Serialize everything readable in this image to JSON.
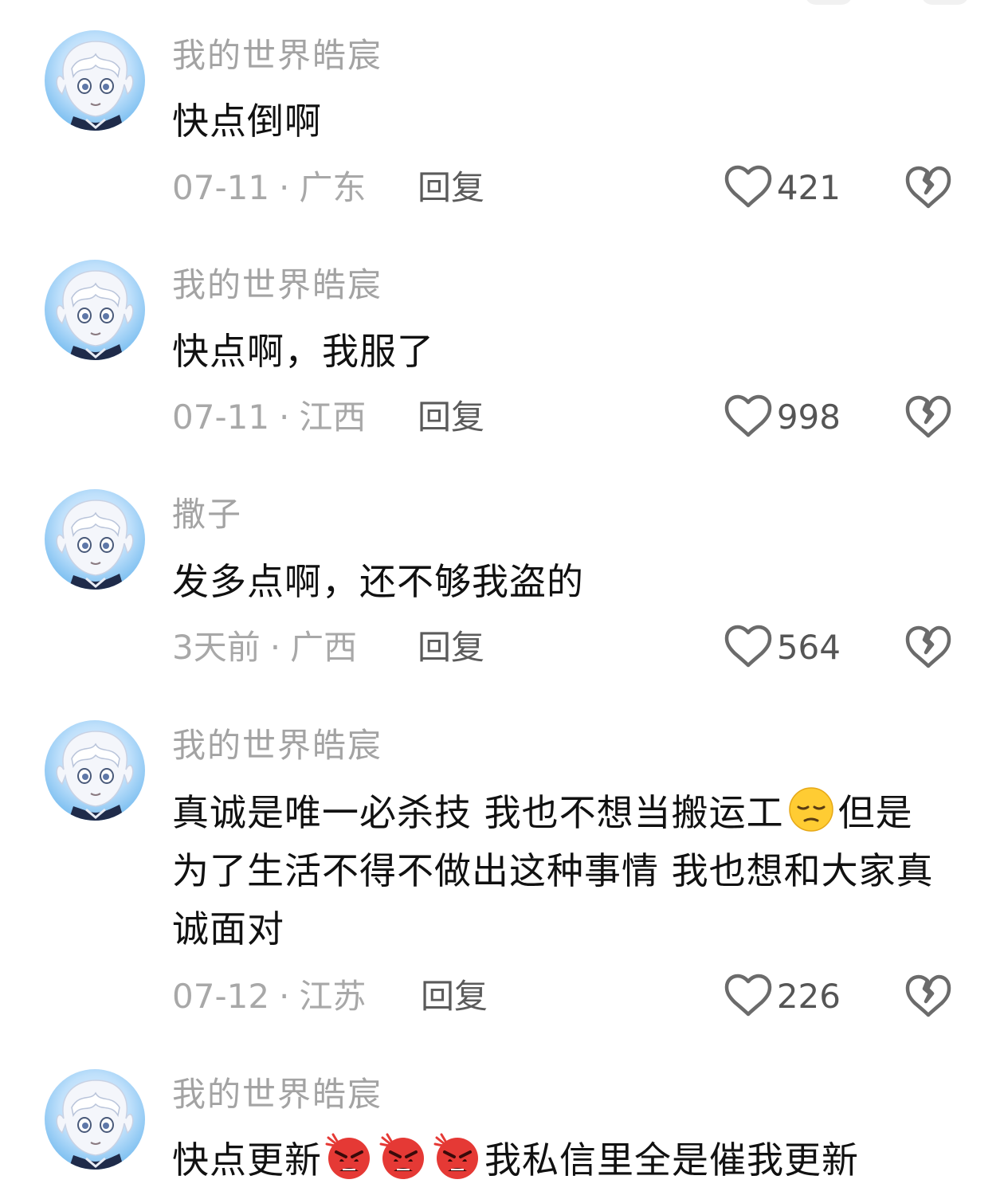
{
  "comments": [
    {
      "username": "我的世界皓宸",
      "text": "快点倒啊",
      "date": "07-11",
      "location": "广东",
      "reply_label": "回复",
      "likes": "421"
    },
    {
      "username": "我的世界皓宸",
      "text": "快点啊，我服了",
      "date": "07-11",
      "location": "江西",
      "reply_label": "回复",
      "likes": "998"
    },
    {
      "username": "撒子",
      "text": "发多点啊，还不够我盗的",
      "date": "3天前",
      "location": "广西",
      "reply_label": "回复",
      "likes": "564"
    },
    {
      "username": "我的世界皓宸",
      "text_before_emoji": "真诚是唯一必杀技 我也不想当搬运工",
      "text_after_emoji": "但是为了生活不得不做出这种事情 我也想和大家真诚面对",
      "emoji": "pensive-face-emoji",
      "date": "07-12",
      "location": "江苏",
      "reply_label": "回复",
      "likes": "226"
    },
    {
      "username": "我的世界皓宸",
      "text_before_emoji": "快点更新",
      "text_after_emoji": "我私信里全是催我更新",
      "emoji": "angry-face-emoji",
      "emoji_count": 3
    }
  ],
  "meta_separator": "·",
  "icons": {
    "like": "heart-outline-icon",
    "dislike": "broken-heart-icon"
  },
  "colors": {
    "username": "#a3a3a3",
    "text": "#111111",
    "meta": "#a8a8a8",
    "icon": "#6b6b6b"
  }
}
